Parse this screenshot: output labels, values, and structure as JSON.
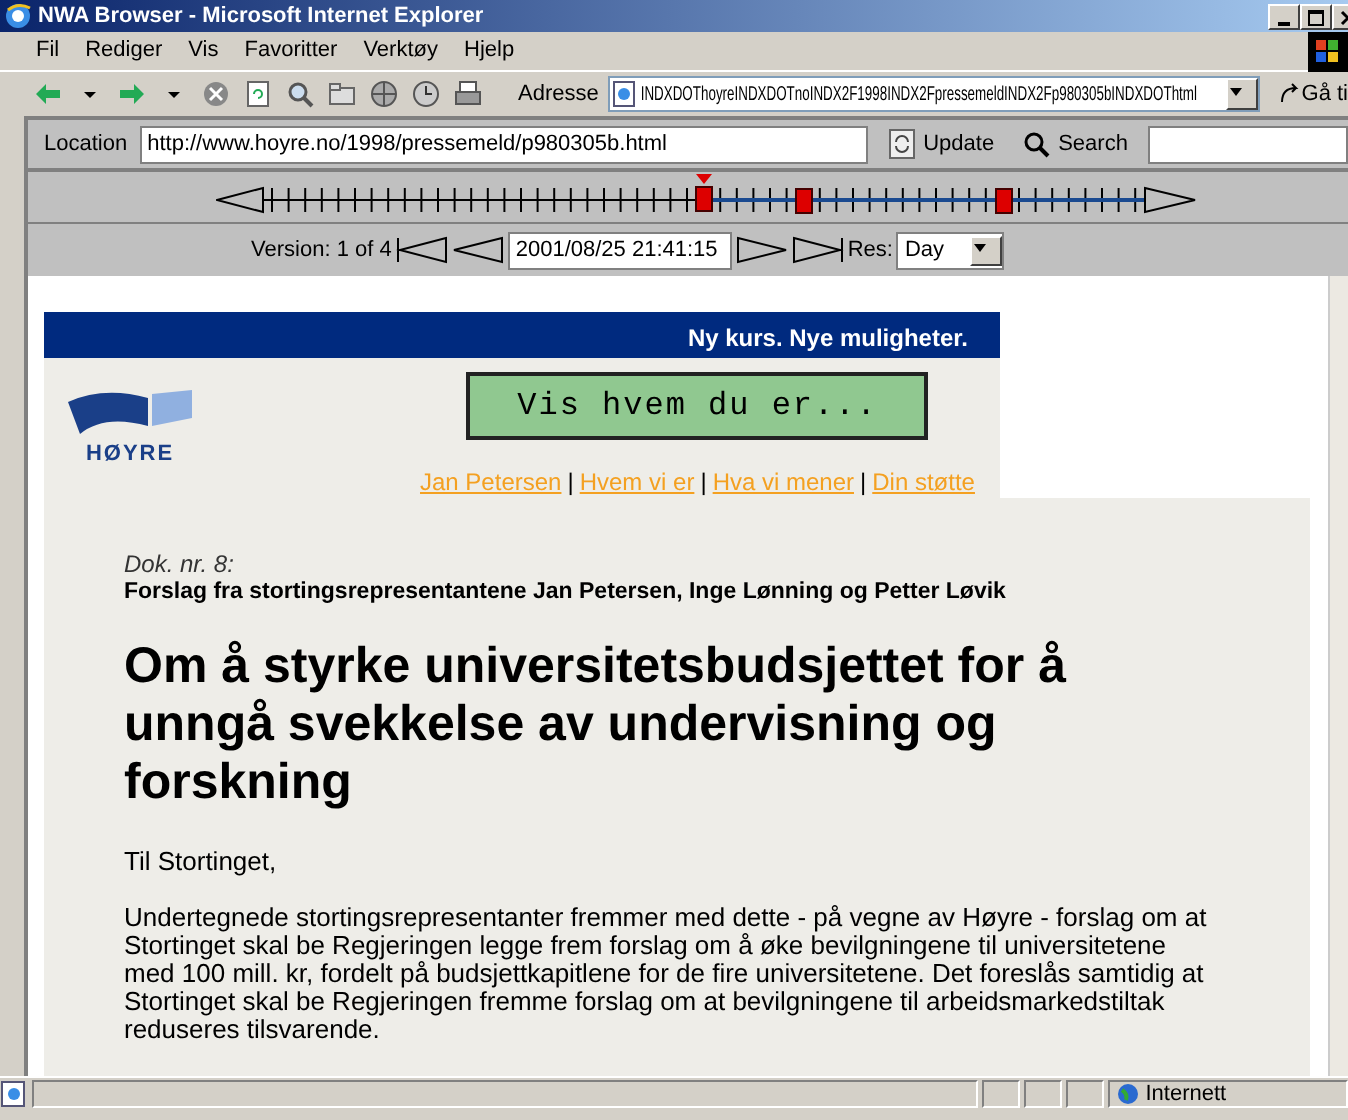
{
  "window": {
    "title": "NWA Browser - Microsoft Internet Explorer"
  },
  "menu": [
    {
      "label": "Fil"
    },
    {
      "label": "Rediger"
    },
    {
      "label": "Vis"
    },
    {
      "label": "Favoritter"
    },
    {
      "label": "Verktøy"
    },
    {
      "label": "Hjelp"
    }
  ],
  "toolbar": {
    "address_label": "Adresse",
    "address": "INDXDOThoyreINDXDOTnoINDX2F1998INDX2FpressemeldINDX2Fp980305bINDXDOThtml",
    "go_label": "Gå ti"
  },
  "location_bar": {
    "label": "Location",
    "url": "http://www.hoyre.no/1998/pressemeld/p980305b.html",
    "update": "Update",
    "search": "Search"
  },
  "timeline": {
    "versions": [
      {
        "level": 0.5,
        "selected": true
      },
      {
        "level": 0.614,
        "selected": false
      },
      {
        "level": 0.84,
        "selected": false
      }
    ]
  },
  "version_bar": {
    "label": "Version: 1 of 4",
    "date": "2001/08/25 21:41:15",
    "res_label": "Res:",
    "res": "Day"
  },
  "page": {
    "banner": "Ny kurs. Nye muligheter.",
    "logo_text": "HØYRE",
    "slogan_button": "Vis hvem du er...",
    "links": [
      "Jan Petersen",
      "Hvem vi er",
      "Hva vi mener",
      "Din støtte"
    ],
    "separators": [
      "|",
      "|",
      "|"
    ],
    "doc_number": "Dok. nr. 8:",
    "byline": "Forslag fra stortingsrepresentantene Jan Petersen, Inge Lønning og Petter Løvik",
    "heading": "Om å styrke universitetsbudsjettet for å unngå svekkelse av undervisning og forskning",
    "salutation": "Til Stortinget,",
    "body": "Undertegnede stortingsrepresentanter fremmer med dette - på vegne av Høyre - forslag om at Stortinget skal be Regjeringen legge frem forslag om å øke bevilgningene til universitetene med 100 mill. kr, fordelt på budsjettkapitlene for de fire universitetene. Det foreslås samtidig at Stortinget skal be Regjeringen fremme forslag om at bevilgningene til arbeidsmarkedstiltak reduseres tilsvarende."
  },
  "status_bar": {
    "zone": "Internett"
  }
}
